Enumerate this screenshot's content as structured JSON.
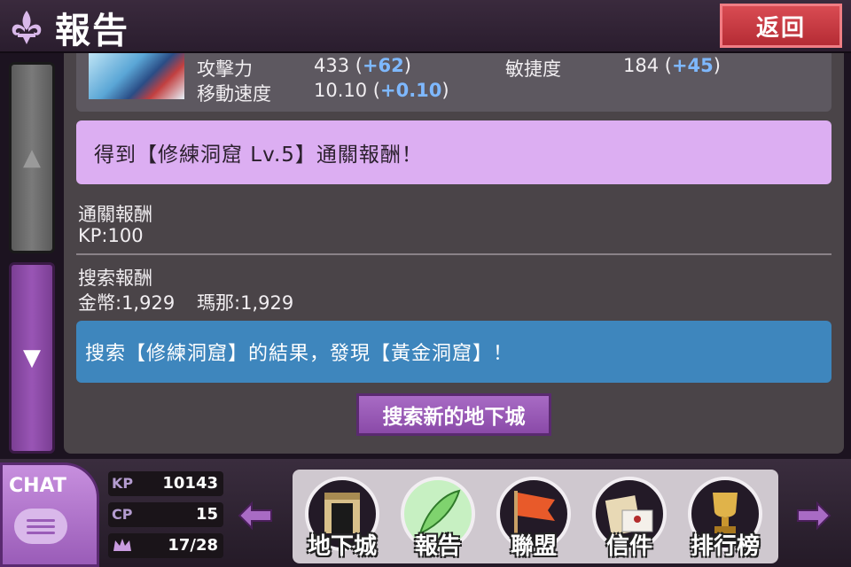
{
  "header": {
    "title": "報告",
    "back_label": "返回"
  },
  "stats": {
    "attack_label": "攻擊力",
    "attack_value": "433 (",
    "attack_bonus": "+62",
    "attack_close": ")",
    "agility_label": "敏捷度",
    "agility_value": "184 (",
    "agility_bonus": "+45",
    "agility_close": ")",
    "speed_label": "移動速度",
    "speed_value": "10.10 (",
    "speed_bonus": "+0.10",
    "speed_close": ")"
  },
  "clear_banner": "得到【修練洞窟 Lv.5】通關報酬！",
  "clear_reward": {
    "title": "通關報酬",
    "value": "KP:100"
  },
  "search_reward": {
    "title": "搜索報酬",
    "gold": "金幣:1,929",
    "mana": "瑪那:1,929"
  },
  "discovery_banner": "搜索【修練洞窟】的結果，發現【黃金洞窟】！",
  "search_button": "搜索新的地下城",
  "scroll": {
    "up_icon": "▲",
    "down_icon": "▼"
  },
  "footer": {
    "chat_label": "CHAT",
    "kp_label": "KP",
    "kp_value": "10143",
    "cp_label": "CP",
    "cp_value": "15",
    "crown_value": "17/28",
    "nav": [
      {
        "label": "地下城",
        "icon": "dungeon-gate-icon"
      },
      {
        "label": "報告",
        "icon": "quill-icon"
      },
      {
        "label": "聯盟",
        "icon": "flag-icon"
      },
      {
        "label": "信件",
        "icon": "letter-icon"
      },
      {
        "label": "排行榜",
        "icon": "trophy-icon"
      }
    ]
  },
  "colors": {
    "accent_purple": "#9a5cb8",
    "back_red": "#c93a42",
    "banner_pink": "#dcaef2",
    "banner_blue": "#3e86bd",
    "bonus_blue": "#7eb8ff"
  }
}
